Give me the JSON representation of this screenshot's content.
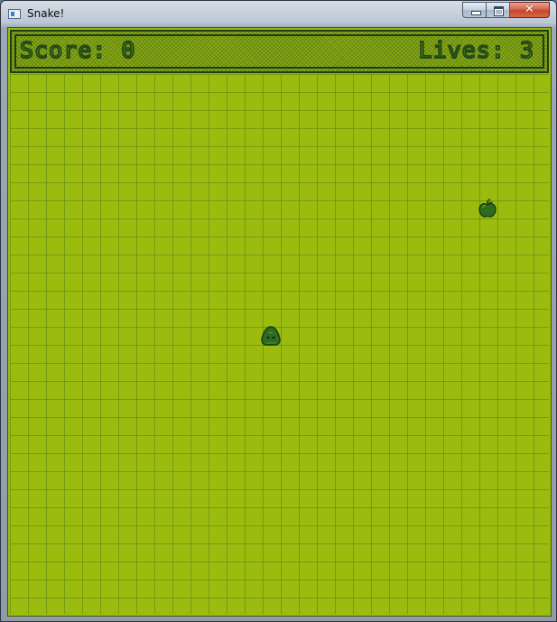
{
  "window": {
    "title": "Snake!",
    "close_glyph": "✕"
  },
  "hud": {
    "score_label": "Score:",
    "score_value": "0",
    "lives_label": "Lives:",
    "lives_value": "3"
  },
  "game": {
    "grid_cell": "square",
    "apple_icon": "apple-icon",
    "snake_icon": "snake-head-icon"
  },
  "colors": {
    "field": "#9bbc0f",
    "grid": "#7aa21a",
    "dark": "#1f3d14"
  }
}
